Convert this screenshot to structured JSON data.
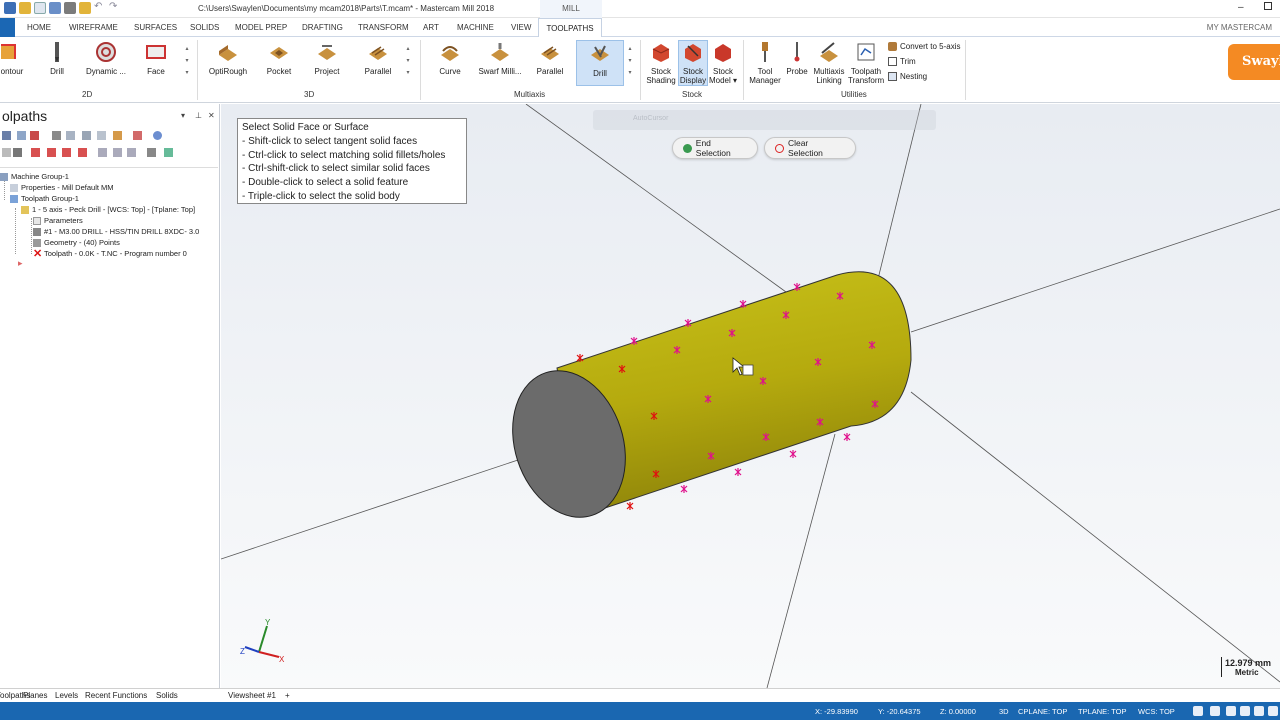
{
  "titlebar": {
    "title": "C:\\Users\\Swaylen\\Documents\\my mcam2018\\Parts\\T.mcam* - Mastercam Mill 2018",
    "context": "MILL",
    "account": "MY MASTERCAM",
    "minimize": "–"
  },
  "tabs": [
    "HOME",
    "WIREFRAME",
    "SURFACES",
    "SOLIDS",
    "MODEL PREP",
    "DRAFTING",
    "TRANSFORM",
    "ART",
    "MACHINE",
    "VIEW",
    "TOOLPATHS"
  ],
  "ribbon": {
    "g2d": {
      "name": "2D",
      "buttons": [
        "ontour",
        "Drill",
        "Dynamic ...",
        "Face"
      ]
    },
    "g3d": {
      "name": "3D",
      "buttons": [
        "OptiRough",
        "Pocket",
        "Project",
        "Parallel"
      ]
    },
    "gmulti": {
      "name": "Multiaxis",
      "buttons": [
        "Curve",
        "Swarf Milli...",
        "Parallel",
        "Drill"
      ]
    },
    "gstock": {
      "name": "Stock",
      "buttons": [
        [
          "Stock",
          "Shading"
        ],
        [
          "Stock",
          "Display"
        ],
        [
          "Stock",
          "Model ▾"
        ]
      ]
    },
    "gutil": {
      "name": "Utilities",
      "buttons": [
        [
          "Tool",
          "Manager"
        ],
        [
          "Probe",
          ""
        ],
        [
          "Multiaxis",
          "Linking"
        ],
        [
          "Toolpath",
          "Transform"
        ]
      ],
      "small": [
        "Convert to 5-axis",
        "Trim",
        "Nesting"
      ]
    },
    "logo": "Swayl"
  },
  "panel": {
    "title": "olpaths",
    "tree": [
      "Machine Group-1",
      "Properties - Mill Default MM",
      "Toolpath Group-1",
      "1 - 5 axis - Peck Drill - [WCS: Top] - [Tplane: Top]",
      "Parameters",
      "#1 - M3.00 DRILL - HSS/TIN DRILL 8XDC- 3.0",
      "Geometry - (40) Points",
      "Toolpath - 0.0K - T.NC - Program number 0"
    ]
  },
  "viewport": {
    "hints": [
      "Select Solid Face or Surface",
      "- Shift-click to select tangent solid faces",
      "- Ctrl-click to select matching solid fillets/holes",
      "- Ctrl-shift-click to select similar solid faces",
      "- Double-click to select a solid feature",
      "- Triple-click to select the solid body"
    ],
    "end_selection": "End Selection",
    "clear_selection": "Clear Selection",
    "ghost_toolbar": "AutoCursor",
    "scale_value": "12.979 mm",
    "scale_unit": "Metric",
    "axis_y": "Y",
    "axis_x": "X",
    "axis_z": "Z",
    "colors": {
      "cylinder": "#c8bd12",
      "end_face": "#6b6b6b",
      "points_selected": "#e0108c",
      "points_red": "#e01010"
    }
  },
  "bottom_tabs": [
    "Toolpaths",
    "Planes",
    "Levels",
    "Recent Functions",
    "Solids"
  ],
  "viewsheet": "Viewsheet #1",
  "add_sheet": "+",
  "status": {
    "x": "X:   -29.83990",
    "y": "Y:   -20.64375",
    "z": "Z:   0.00000",
    "mode": "3D",
    "cplane": "CPLANE: TOP",
    "tplane": "TPLANE: TOP",
    "wcs": "WCS: TOP"
  }
}
